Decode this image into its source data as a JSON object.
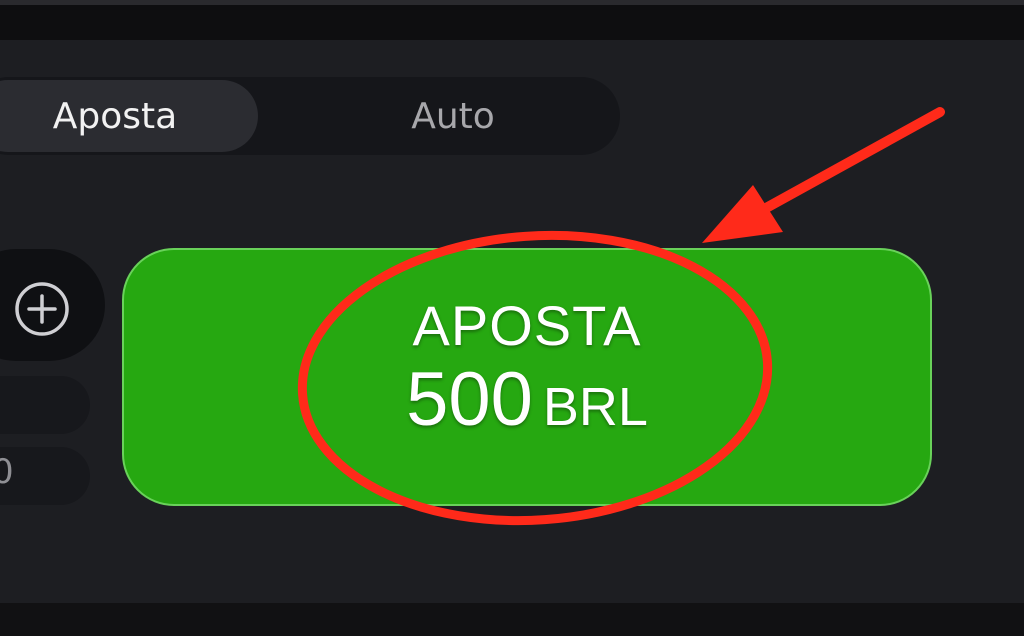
{
  "tabs": {
    "bet_label": "Aposta",
    "auto_label": "Auto"
  },
  "amount_field": {
    "partial_value": "0"
  },
  "bet_button": {
    "label": "APOSTA",
    "amount": "500",
    "currency": "BRL",
    "color": "#26a811"
  },
  "icons": {
    "increment": "plus-circle-icon"
  },
  "annotation": {
    "color": "#ff2a1a",
    "shapes": [
      "ellipse-highlight",
      "arrow"
    ]
  }
}
